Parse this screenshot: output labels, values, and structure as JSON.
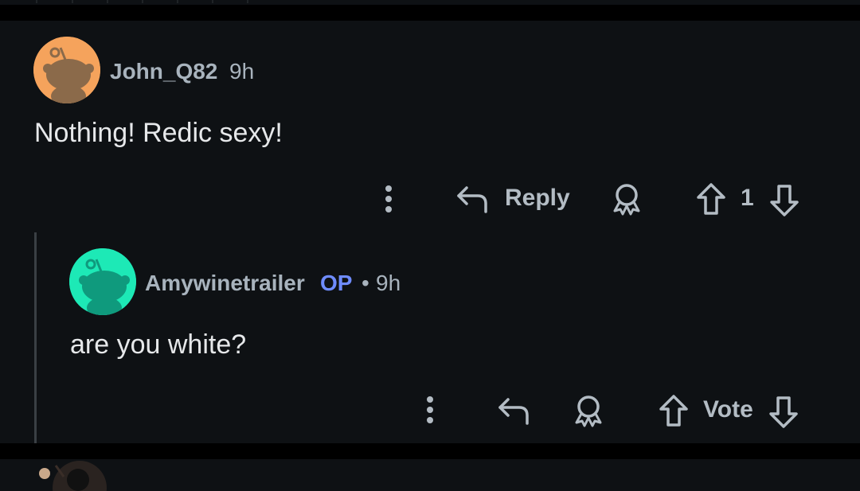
{
  "theme": {
    "background": "#0e1114",
    "text": "#e6e8ea",
    "muted": "#a8b3bd",
    "op_accent": "#6f8cff"
  },
  "comments": [
    {
      "username": "John_Q82",
      "time": "9h",
      "avatar_color": "#f5a35c",
      "body": "Nothing! Redic sexy!",
      "actions": {
        "more_icon": "more-vertical-icon",
        "reply_label": "Reply",
        "award_icon": "award-icon",
        "score": "1"
      }
    },
    {
      "username": "Amywinetrailer",
      "op_badge": "OP",
      "separator": "•",
      "time": "9h",
      "avatar_color": "#1de9b6",
      "body": "are you white?",
      "actions": {
        "more_icon": "more-vertical-icon",
        "reply_icon": "reply-icon",
        "award_icon": "award-icon",
        "vote_label": "Vote"
      }
    }
  ]
}
